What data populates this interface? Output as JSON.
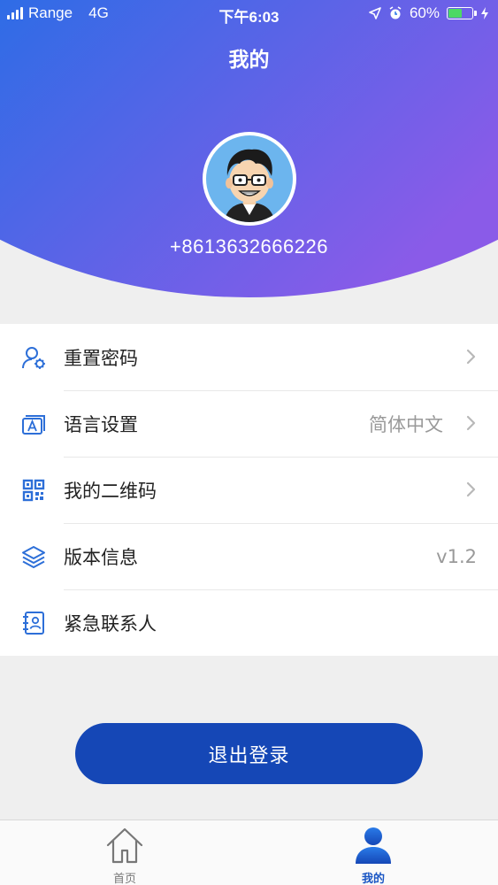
{
  "status_bar": {
    "carrier": "Range",
    "network": "4G",
    "time": "下午6:03",
    "battery_percent": "60%",
    "battery_level": 0.6
  },
  "header": {
    "title": "我的",
    "phone": "+8613632666226"
  },
  "menu": {
    "items": [
      {
        "label": "重置密码",
        "value": "",
        "icon": "user-gear-icon",
        "chevron": true
      },
      {
        "label": "语言设置",
        "value": "简体中文",
        "icon": "language-icon",
        "chevron": true
      },
      {
        "label": "我的二维码",
        "value": "",
        "icon": "qr-code-icon",
        "chevron": true
      },
      {
        "label": "版本信息",
        "value": "v1.2",
        "icon": "layers-icon",
        "chevron": false
      },
      {
        "label": "紧急联系人",
        "value": "",
        "icon": "contact-book-icon",
        "chevron": false
      }
    ]
  },
  "logout": {
    "label": "退出登录"
  },
  "tabbar": {
    "tabs": [
      {
        "label": "首页",
        "icon": "home-icon",
        "active": false
      },
      {
        "label": "我的",
        "icon": "person-icon",
        "active": true
      }
    ]
  },
  "colors": {
    "gradient_start": "#1f6fe6",
    "gradient_end": "#8a5be8",
    "accent": "#1a56c4",
    "button": "#1547b6",
    "icon": "#2d6fd8"
  }
}
